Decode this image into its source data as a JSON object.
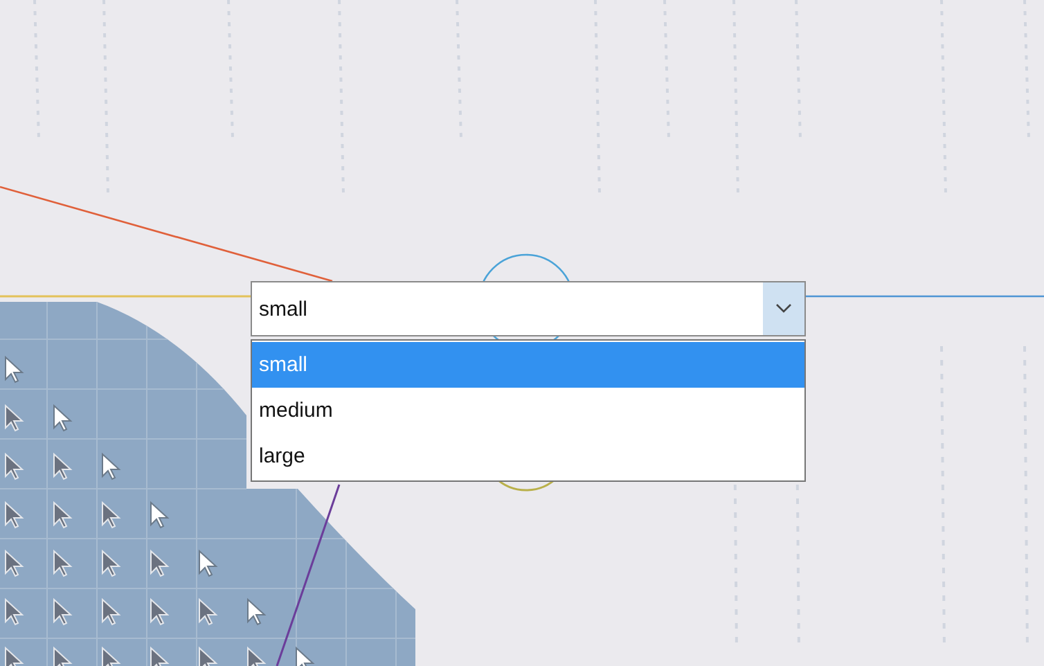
{
  "dropdown": {
    "value": "small",
    "expanded": true,
    "options": [
      {
        "label": "small",
        "selected": true
      },
      {
        "label": "medium",
        "selected": false
      },
      {
        "label": "large",
        "selected": false
      }
    ]
  }
}
